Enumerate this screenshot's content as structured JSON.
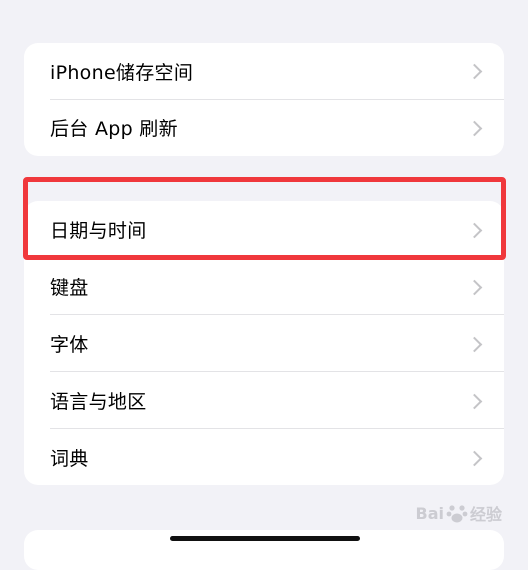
{
  "group1": {
    "items": [
      {
        "label": "iPhone储存空间"
      },
      {
        "label": "后台 App 刷新"
      }
    ]
  },
  "group2": {
    "items": [
      {
        "label": "日期与时间"
      },
      {
        "label": "键盘"
      },
      {
        "label": "字体"
      },
      {
        "label": "语言与地区"
      },
      {
        "label": "词典"
      }
    ]
  },
  "watermark": {
    "left_text": "Bai",
    "right_text": "经验"
  },
  "colors": {
    "background": "#f2f2f7",
    "card": "#ffffff",
    "highlight": "#f0383c",
    "chevron": "#c4c4c7"
  }
}
